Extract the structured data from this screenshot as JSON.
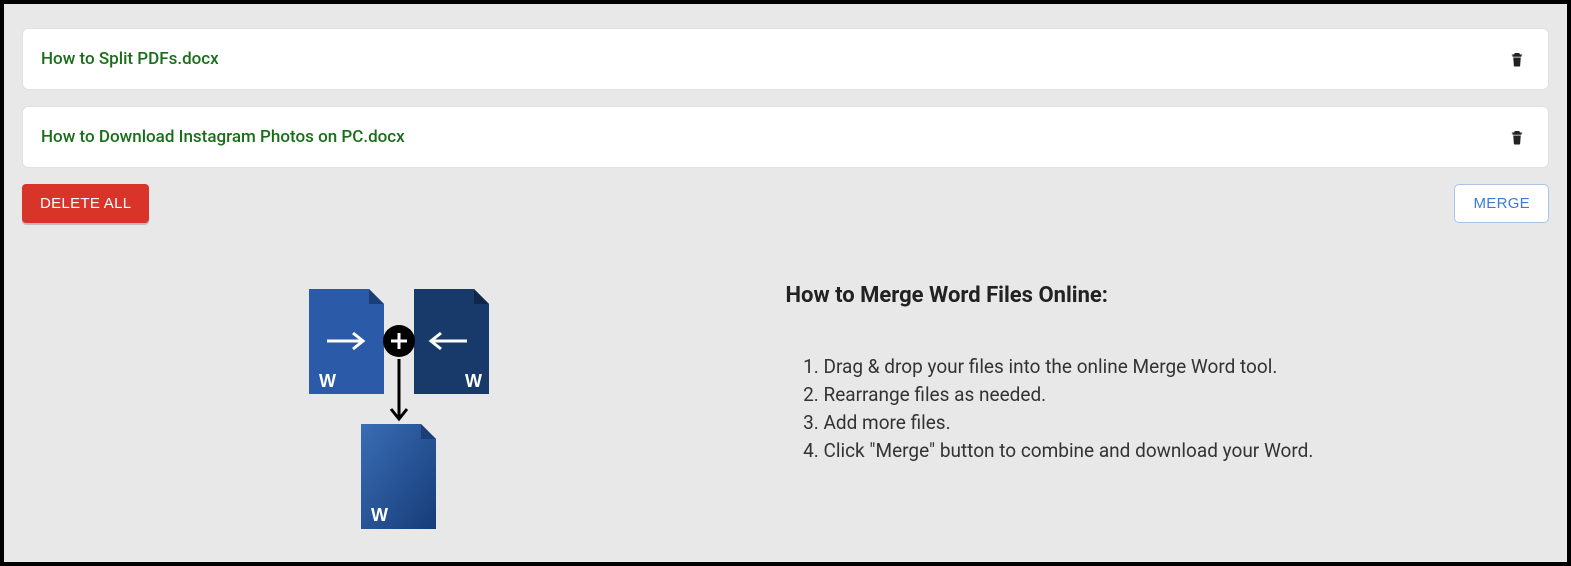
{
  "files": [
    {
      "name": "How to Split PDFs.docx"
    },
    {
      "name": "How to Download Instagram Photos on PC.docx"
    }
  ],
  "buttons": {
    "delete_all": "DELETE ALL",
    "merge": "MERGE"
  },
  "info": {
    "title": "How to Merge Word Files Online:",
    "steps": [
      "Drag & drop your files into the online Merge Word tool.",
      "Rearrange files as needed.",
      "Add more files.",
      "Click \"Merge\" button to combine and download your Word."
    ]
  },
  "illustration": {
    "file_label": "W"
  }
}
